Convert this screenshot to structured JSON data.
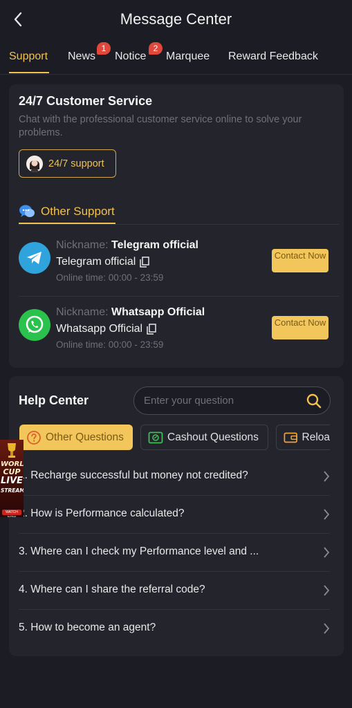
{
  "header": {
    "title": "Message Center"
  },
  "tabs": [
    {
      "label": "Support",
      "active": true
    },
    {
      "label": "News",
      "badge": "1"
    },
    {
      "label": "Notice",
      "badge": "2"
    },
    {
      "label": "Marquee"
    },
    {
      "label": "Reward Feedback"
    }
  ],
  "customer_service": {
    "title": "24/7 Customer Service",
    "description": "Chat with the professional customer service online to solve your problems.",
    "button_label": "24/7 support"
  },
  "other_support": {
    "label": "Other Support",
    "contacts": [
      {
        "nickname_label": "Nickname:",
        "nickname": "Telegram official",
        "account": "Telegram official",
        "online_label": "Online time:",
        "online_time": "00:00 - 23:59",
        "button_label": "Contact Now",
        "icon": "telegram-icon"
      },
      {
        "nickname_label": "Nickname:",
        "nickname": "Whatsapp Official",
        "account": "Whatsapp Official",
        "online_label": "Online time:",
        "online_time": "00:00 - 23:59",
        "button_label": "Contact Now",
        "icon": "whatsapp-icon"
      }
    ]
  },
  "help_center": {
    "title": "Help Center",
    "search_placeholder": "Enter your question",
    "categories": [
      {
        "label": "Other Questions",
        "active": true,
        "icon": "question-icon"
      },
      {
        "label": "Cashout Questions",
        "icon": "cashout-icon"
      },
      {
        "label": "Reloa",
        "icon": "wallet-icon"
      }
    ],
    "faqs": [
      "1. Recharge successful but money not credited?",
      "2. How is Performance calculated?",
      "3. Where can I check my Performance level and ...",
      "4. Where can I share the referral code?",
      "5. How to become an agent?"
    ]
  },
  "promo": {
    "line1": "WORLD",
    "line2": "CUP",
    "line3": "LIVE",
    "line4": "STREAM",
    "button": "WATCH NOW"
  },
  "colors": {
    "accent": "#f2c14e",
    "background": "#1c1d24",
    "card": "#23242c",
    "badge": "#e2473b"
  }
}
